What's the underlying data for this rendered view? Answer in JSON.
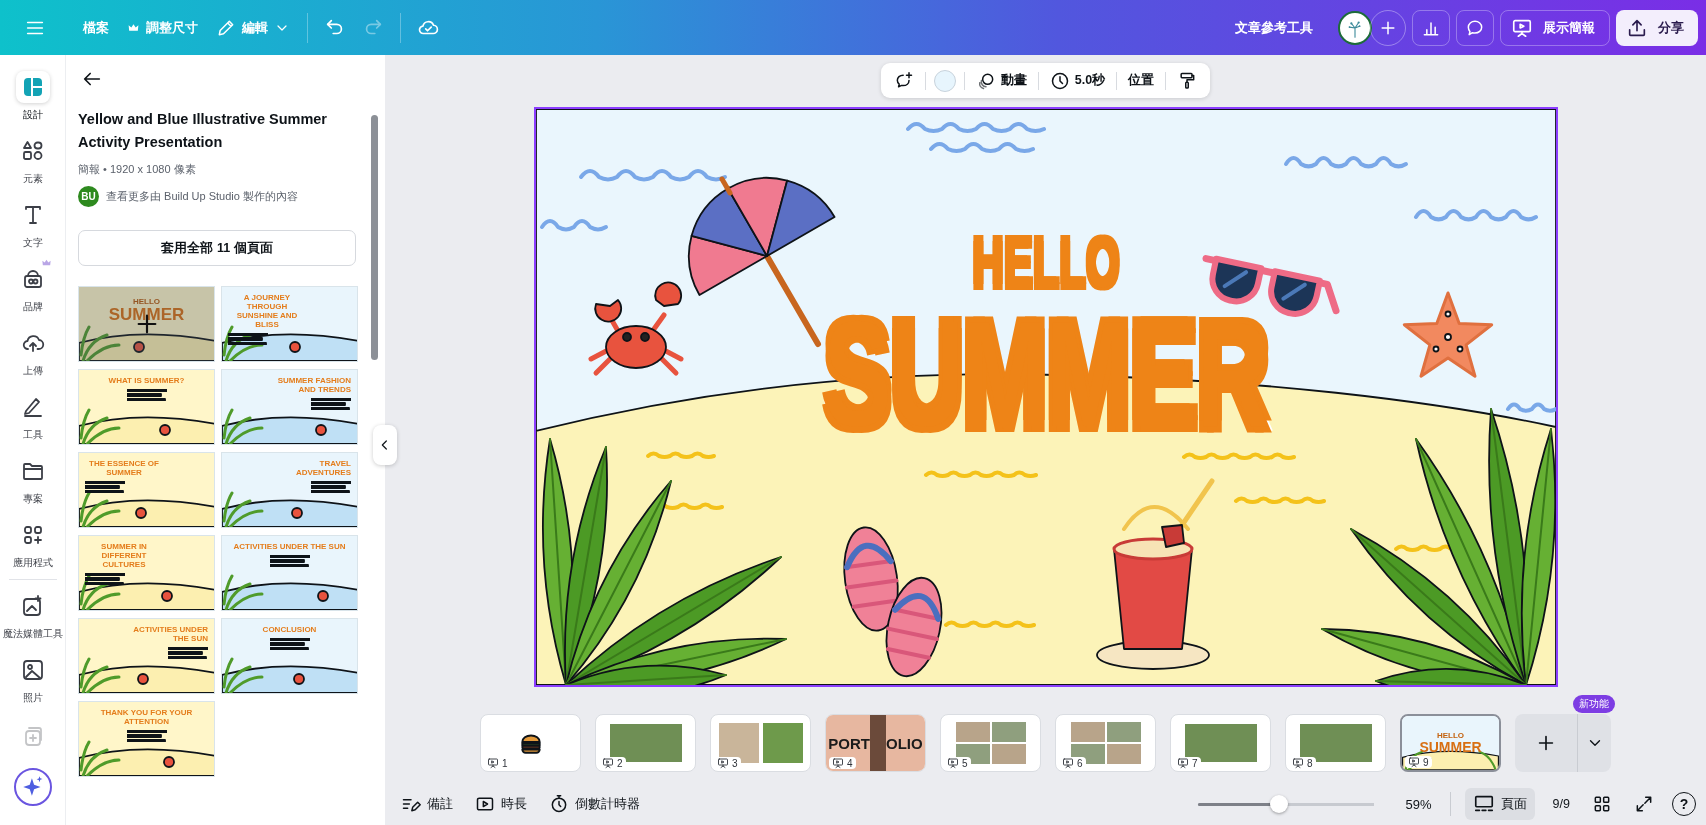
{
  "top_bar": {
    "file": "檔案",
    "resize": {
      "label": "調整尺寸",
      "premium": true
    },
    "edit": "編輯",
    "undo": {
      "disabled": false
    },
    "redo": {
      "disabled": true
    },
    "tool_link": "文章參考工具",
    "present": "展示簡報",
    "share": "分享"
  },
  "rail": {
    "items": [
      {
        "label": "設計",
        "selected": true,
        "premium": false
      },
      {
        "label": "元素",
        "selected": false,
        "premium": false
      },
      {
        "label": "文字",
        "selected": false,
        "premium": false
      },
      {
        "label": "品牌",
        "selected": false,
        "premium": true
      },
      {
        "label": "上傳",
        "selected": false,
        "premium": false
      },
      {
        "label": "工具",
        "selected": false,
        "premium": false
      },
      {
        "label": "專案",
        "selected": false,
        "premium": false
      },
      {
        "label": "應用程式",
        "selected": false,
        "premium": false
      },
      {
        "label": "魔法媒體工具",
        "selected": false,
        "premium": false
      },
      {
        "label": "照片",
        "selected": false,
        "premium": false
      }
    ],
    "extra_button": {
      "disabled": true
    }
  },
  "panel": {
    "title": "Yellow and Blue Illustrative Summer Activity Presentation",
    "meta": "簡報 • 1920 x 1080 像素",
    "creator_badge": "BU",
    "creator_link": "查看更多由 Build Up Studio 製作的內容",
    "apply_button": "套用全部 11 個頁面",
    "templates": [
      {
        "kind": "cover",
        "headline": "HELLO",
        "title": "SUMMER",
        "hovered": true
      },
      {
        "kind": "left",
        "title": "A JOURNEY THROUGH SUNSHINE AND BLISS",
        "hovered": false
      },
      {
        "kind": "center",
        "title": "WHAT IS SUMMER?",
        "hovered": false
      },
      {
        "kind": "right",
        "title": "SUMMER FASHION AND TRENDS",
        "hovered": false
      },
      {
        "kind": "left",
        "title": "THE ESSENCE OF SUMMER",
        "hovered": false
      },
      {
        "kind": "right",
        "title": "TRAVEL ADVENTURES",
        "hovered": false
      },
      {
        "kind": "left",
        "title": "SUMMER IN DIFFERENT CULTURES",
        "hovered": false
      },
      {
        "kind": "center",
        "title": "ACTIVITIES UNDER THE SUN",
        "hovered": false
      },
      {
        "kind": "right",
        "title": "ACTIVITIES UNDER THE SUN",
        "hovered": false
      },
      {
        "kind": "center",
        "title": "CONCLUSION",
        "hovered": false
      },
      {
        "kind": "center",
        "title": "THANK YOU FOR YOUR ATTENTION",
        "hovered": false
      }
    ]
  },
  "toolbar": {
    "animate": "動畫",
    "duration": "5.0秒",
    "position": "位置"
  },
  "slide": {
    "selected": true,
    "headline": "HELLO",
    "title": "SUMMER"
  },
  "pages": [
    {
      "number": "1",
      "kind": "icon",
      "selected": false
    },
    {
      "number": "2",
      "kind": "photo",
      "selected": false
    },
    {
      "number": "3",
      "kind": "photo_pair",
      "selected": false
    },
    {
      "number": "4",
      "kind": "portfolio",
      "texts": [
        "PORT",
        "OLIO"
      ],
      "selected": false
    },
    {
      "number": "5",
      "kind": "collage",
      "selected": false
    },
    {
      "number": "6",
      "kind": "collage",
      "selected": false
    },
    {
      "number": "7",
      "kind": "photo",
      "selected": false
    },
    {
      "number": "8",
      "kind": "photo",
      "selected": false
    },
    {
      "number": "9",
      "kind": "design",
      "headline": "HELLO",
      "title": "SUMMER",
      "selected": true
    }
  ],
  "add_page": {
    "badge": "新功能"
  },
  "bottom_bar": {
    "notes": "備註",
    "duration": "時長",
    "timer": "倒數計時器",
    "zoom": {
      "level": 0.46
    },
    "zoom_reading": "59%",
    "page_view": {
      "label": "頁面",
      "selected": true
    },
    "page_count": "9/9",
    "help": "?"
  }
}
